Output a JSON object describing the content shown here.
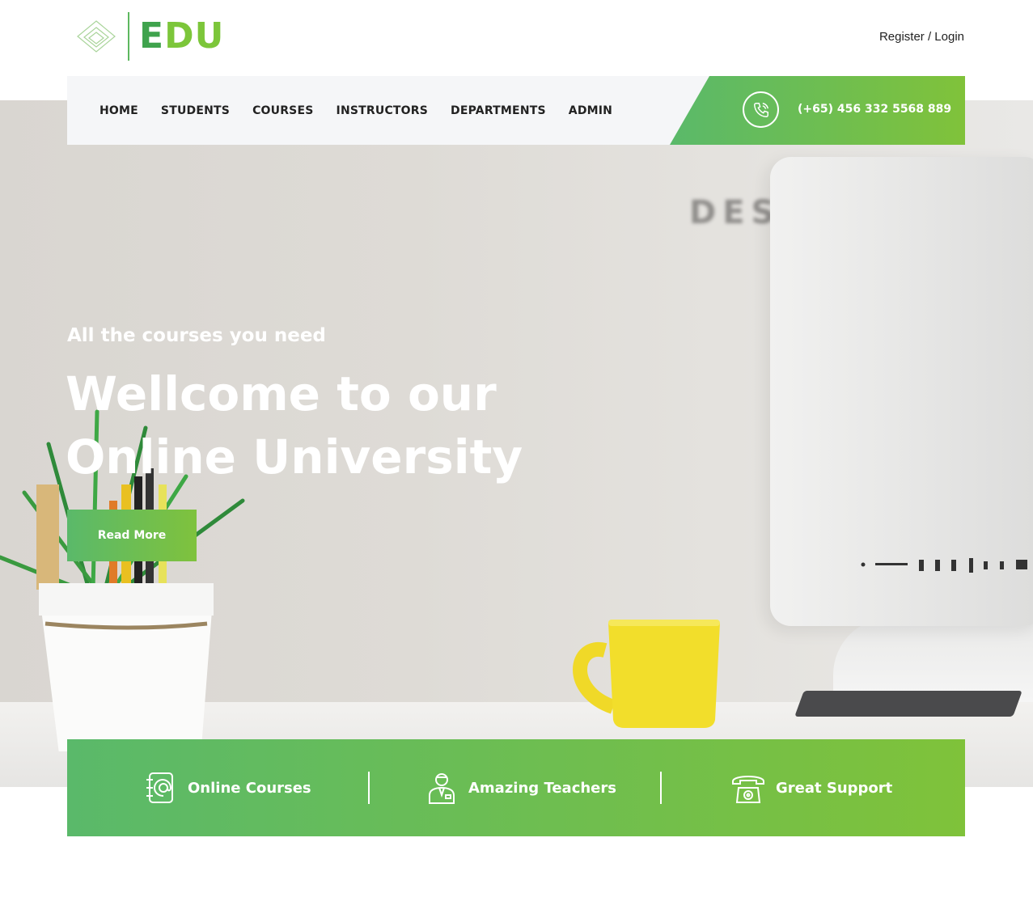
{
  "header": {
    "logo": {
      "text_first": "E",
      "text_rest": "DU"
    },
    "auth_link": "Register / Login"
  },
  "nav": {
    "items": [
      "HOME",
      "STUDENTS",
      "COURSES",
      "INSTRUCTORS",
      "DEPARTMENTS",
      "ADMIN"
    ],
    "phone": "(+65) 456 332 5568 889"
  },
  "hero": {
    "background_word": "DES",
    "subtitle": "All the courses you need",
    "title_line1": "Wellcome to our",
    "title_line2": "Online University",
    "cta_label": "Read More"
  },
  "features": [
    {
      "label": "Online Courses",
      "icon": "address-book-icon"
    },
    {
      "label": "Amazing Teachers",
      "icon": "teacher-icon"
    },
    {
      "label": "Great Support",
      "icon": "telephone-icon"
    }
  ],
  "colors": {
    "brand_green": "#5ab96a",
    "brand_lime": "#80c23a",
    "nav_bg": "#f5f6f8",
    "mug_yellow": "#f2de2b"
  }
}
